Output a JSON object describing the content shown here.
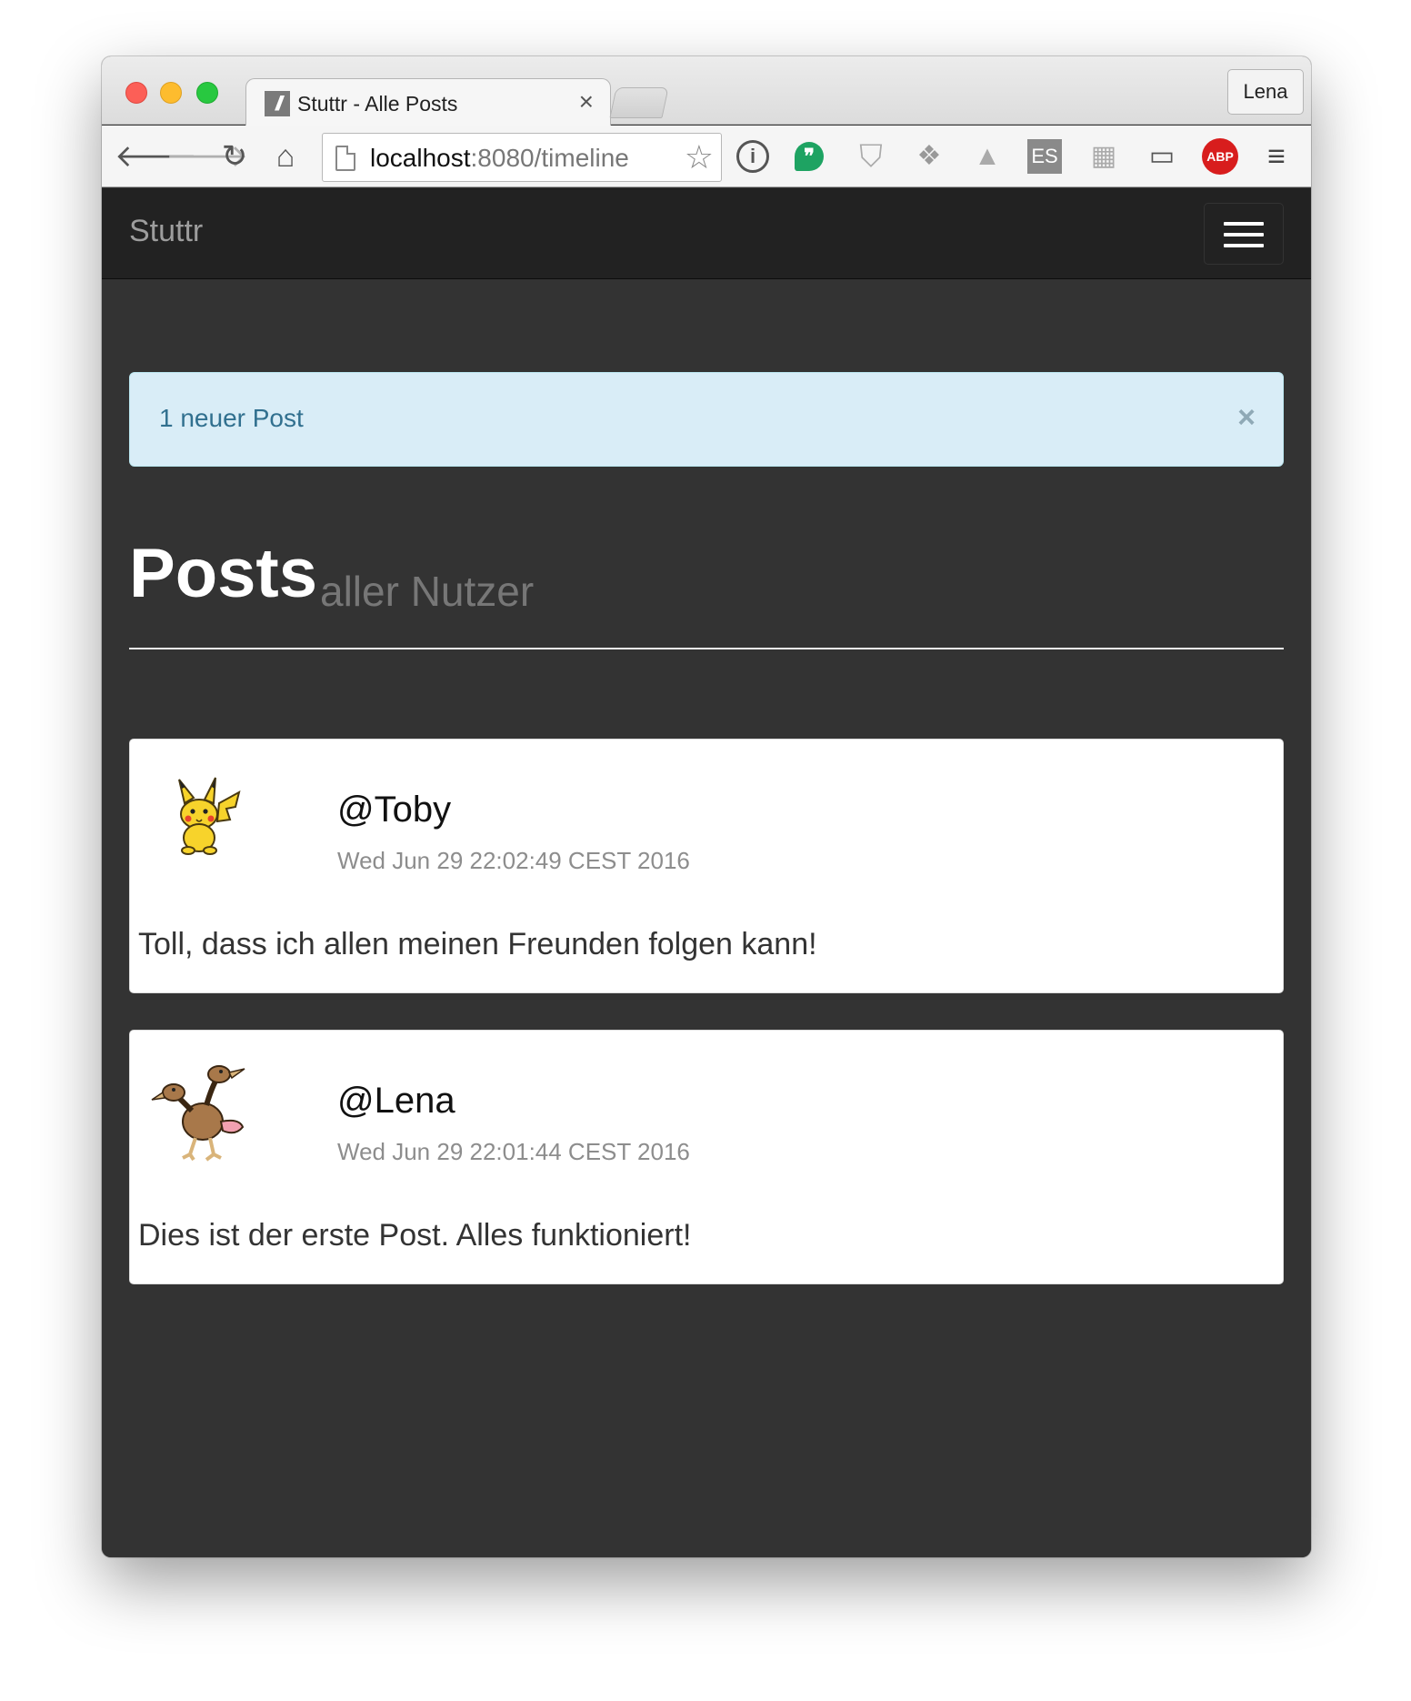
{
  "browser": {
    "tab_title": "Stuttr - Alle Posts",
    "tab_close": "×",
    "profile": "Lena",
    "url_host": "localhost",
    "url_path": ":8080/timeline",
    "extensions": [
      "1password-icon",
      "hangouts-icon",
      "shield-icon",
      "dropbox-icon",
      "drive-icon",
      "es-icon",
      "layout-icon",
      "cast-icon",
      "adblock-plus-icon",
      "menu-icon"
    ],
    "es_label": "ES",
    "abp_label": "ABP"
  },
  "navbar": {
    "brand": "Stuttr"
  },
  "alert": {
    "text": "1 neuer Post",
    "close": "×",
    "background": "#d9edf7",
    "text_color": "#31708f"
  },
  "header": {
    "title": "Posts",
    "subtitle": "aller Nutzer"
  },
  "posts": [
    {
      "user": "@Toby",
      "time": "Wed Jun 29 22:02:49 CEST 2016",
      "text": "Toll, dass ich allen meinen Freunden folgen kann!",
      "avatar": "pikachu-avatar"
    },
    {
      "user": "@Lena",
      "time": "Wed Jun 29 22:01:44 CEST 2016",
      "text": "Dies ist der erste Post. Alles funktioniert!",
      "avatar": "doduo-avatar"
    }
  ],
  "colors": {
    "page_bg": "#333333",
    "navbar_bg": "#222222",
    "card_bg": "#ffffff"
  }
}
